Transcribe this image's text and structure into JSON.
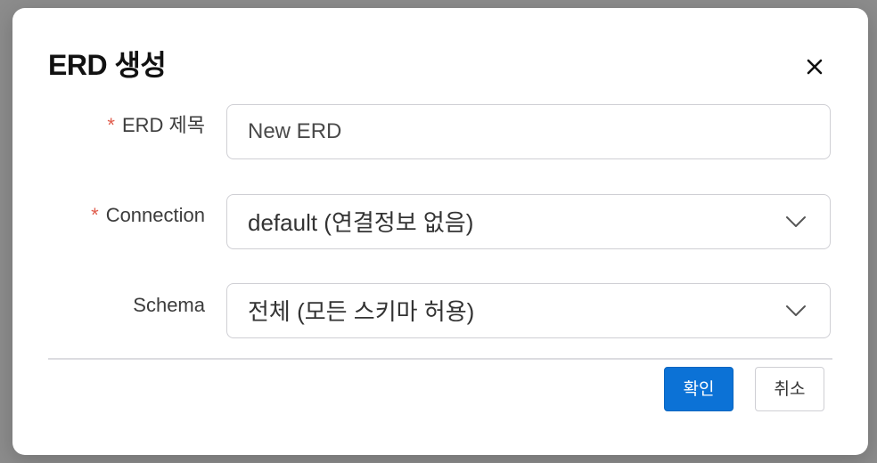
{
  "dialog": {
    "title": "ERD 생성",
    "close_icon": "close-icon"
  },
  "form": {
    "required_marker": "*",
    "erd_name": {
      "label": "ERD 제목",
      "required": true,
      "value": "New ERD"
    },
    "connection": {
      "label": "Connection",
      "required": true,
      "selected": "default (연결정보 없음)",
      "icon": "chevron-down-icon"
    },
    "schema": {
      "label": "Schema",
      "required": false,
      "selected": "전체 (모든 스키마 허용)",
      "icon": "chevron-down-icon"
    }
  },
  "footer": {
    "confirm_label": "확인",
    "cancel_label": "취소"
  },
  "colors": {
    "primary": "#0c72d6",
    "required": "#e05b4b",
    "overlay": "#8a8a8a"
  }
}
